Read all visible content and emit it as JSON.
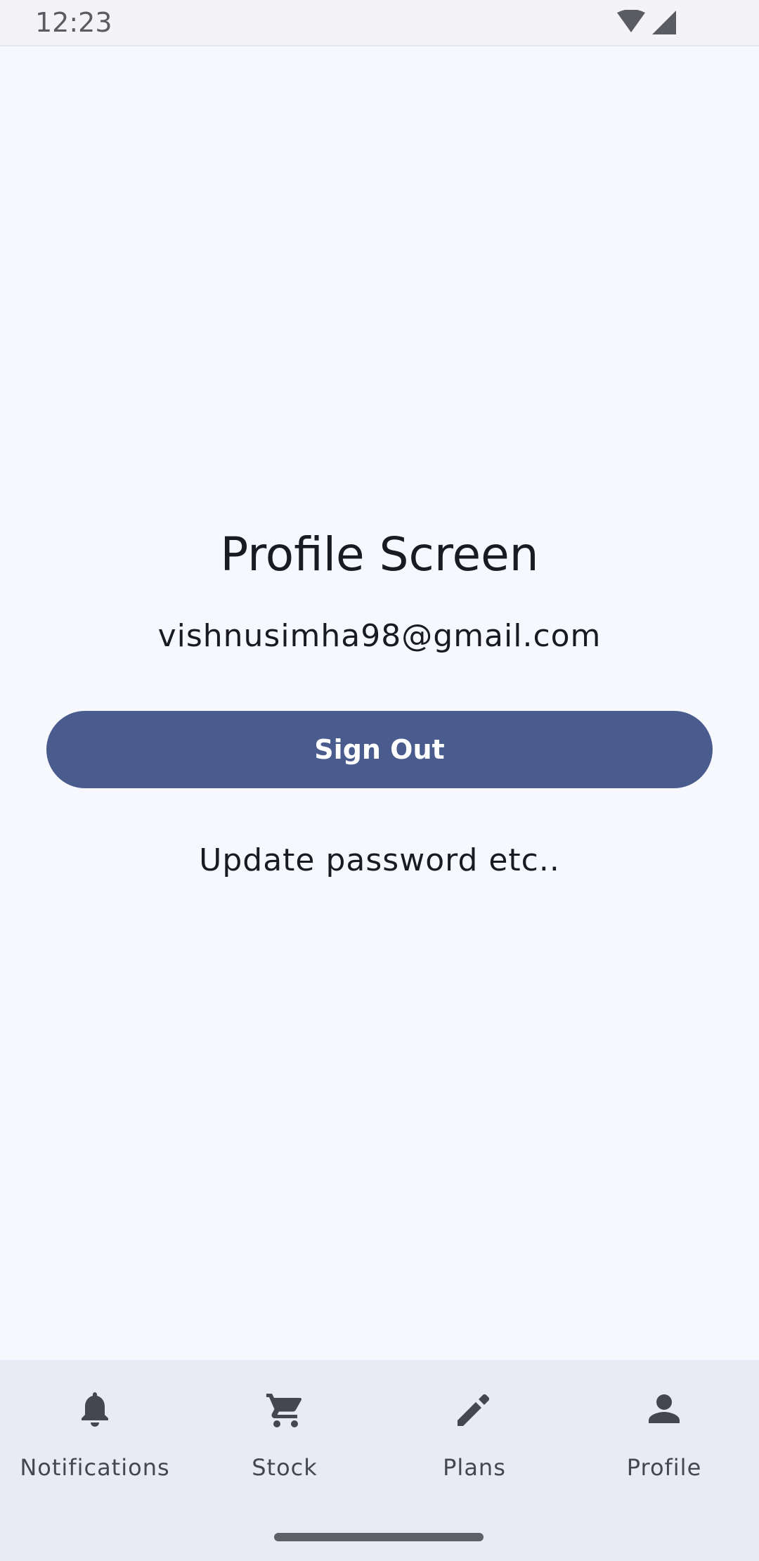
{
  "status_bar": {
    "time": "12:23",
    "icons": [
      "wifi-icon",
      "cellular-signal-icon"
    ]
  },
  "profile": {
    "title": "Profile Screen",
    "email": "vishnusimha98@gmail.com",
    "sign_out_label": "Sign Out",
    "update_text": "Update password etc.."
  },
  "bottom_nav": {
    "items": [
      {
        "label": "Notifications",
        "icon": "bell-icon"
      },
      {
        "label": "Stock",
        "icon": "cart-icon"
      },
      {
        "label": "Plans",
        "icon": "pencil-icon"
      },
      {
        "label": "Profile",
        "icon": "person-icon"
      }
    ]
  },
  "colors": {
    "background": "#f7f8fd",
    "primary_button": "#4a5b8e",
    "nav_background": "#e8eaf5",
    "nav_icon": "#45464f"
  }
}
